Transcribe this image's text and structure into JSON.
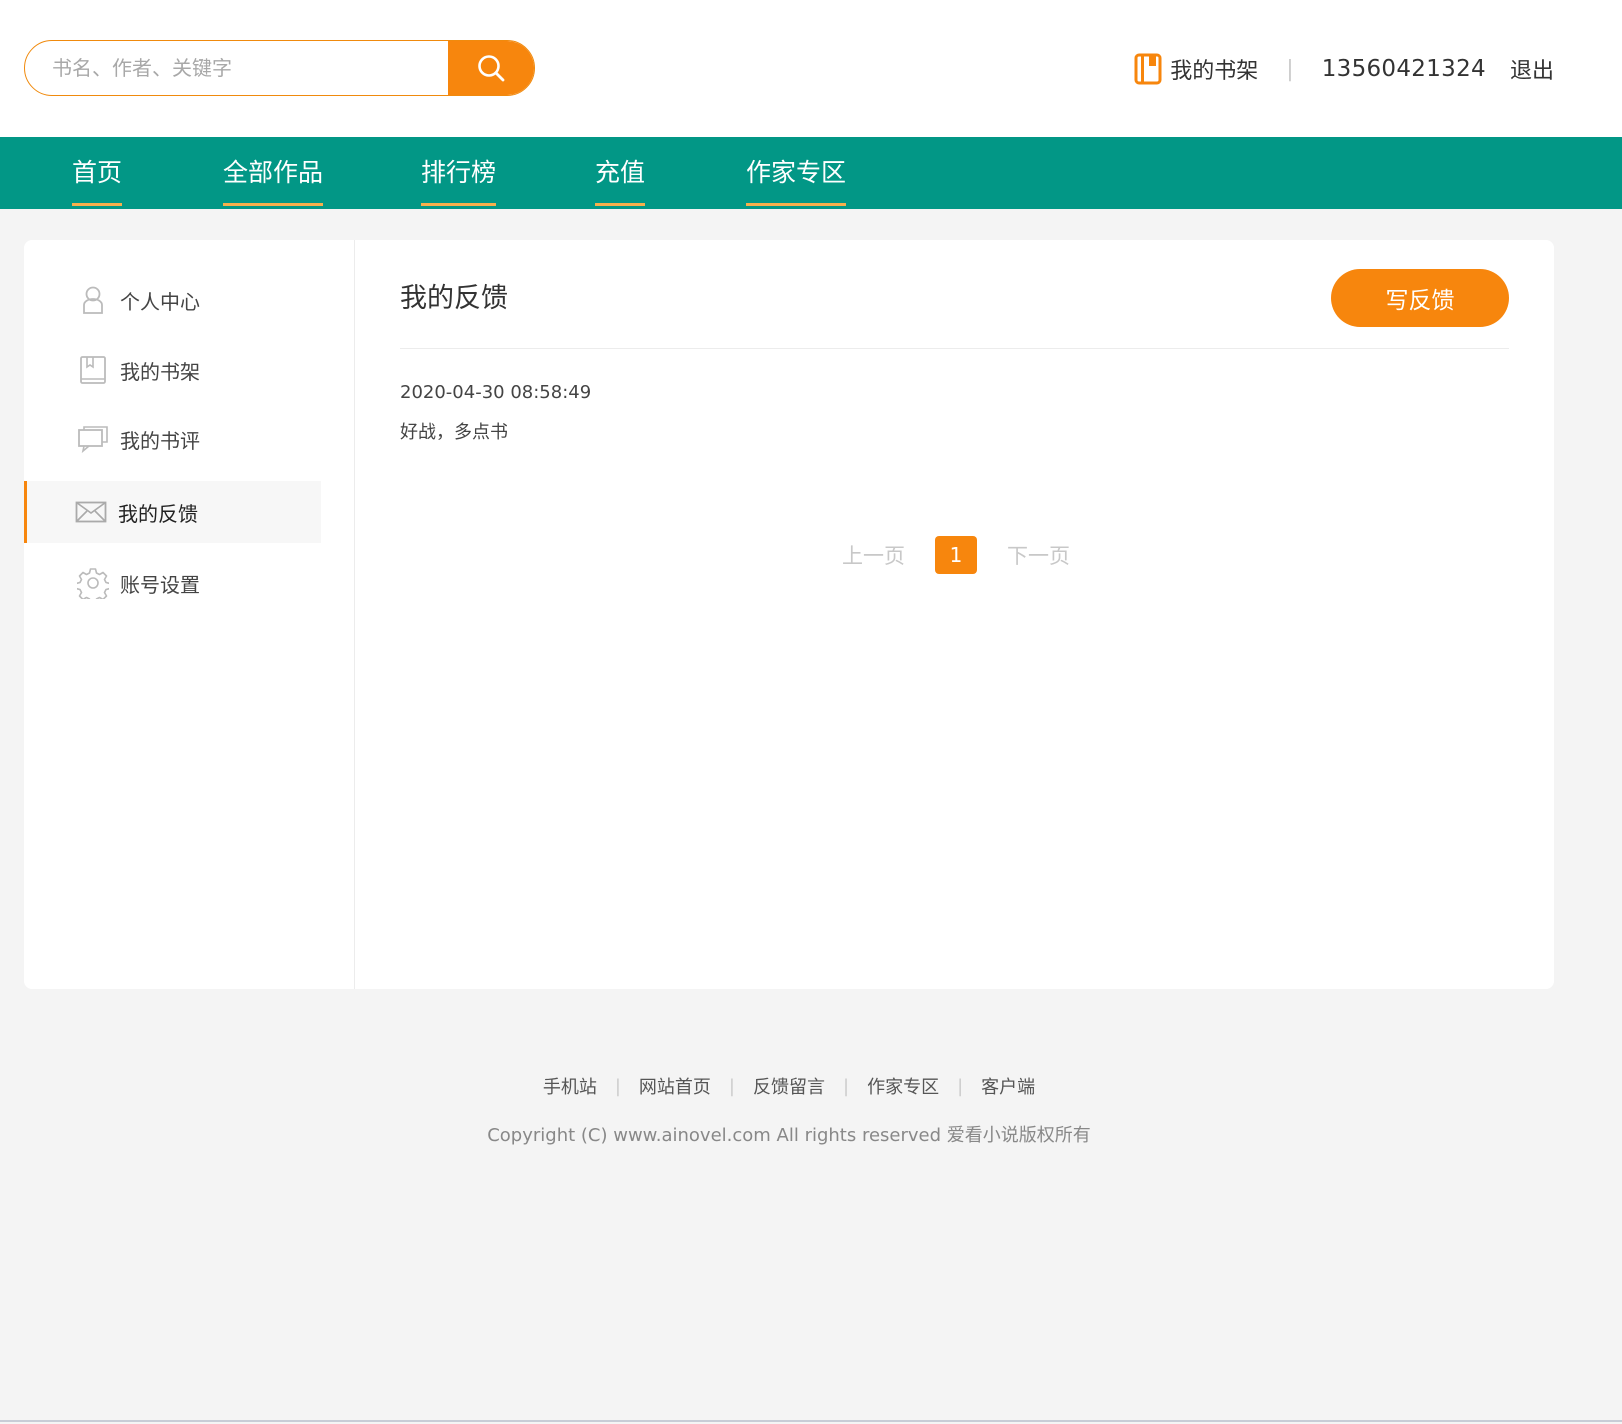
{
  "header": {
    "search_placeholder": "书名、作者、关键字",
    "shelf_label": "我的书架",
    "separator": "|",
    "phone": "13560421324",
    "logout_label": "退出"
  },
  "nav": {
    "items": [
      {
        "label": "首页"
      },
      {
        "label": "全部作品"
      },
      {
        "label": "排行榜"
      },
      {
        "label": "充值"
      },
      {
        "label": "作家专区"
      }
    ]
  },
  "sidebar": {
    "items": [
      {
        "label": "个人中心",
        "icon": "user-icon"
      },
      {
        "label": "我的书架",
        "icon": "book-icon"
      },
      {
        "label": "我的书评",
        "icon": "comment-icon"
      },
      {
        "label": "我的反馈",
        "icon": "mail-icon",
        "active": true
      },
      {
        "label": "账号设置",
        "icon": "gear-icon"
      }
    ]
  },
  "content": {
    "title": "我的反馈",
    "write_button": "写反馈",
    "feedback": [
      {
        "time": "2020-04-30 08:58:49",
        "text": "好战，多点书"
      }
    ]
  },
  "pager": {
    "prev": "上一页",
    "current": "1",
    "next": "下一页"
  },
  "footer": {
    "links": [
      "手机站",
      "网站首页",
      "反馈留言",
      "作家专区",
      "客户端"
    ],
    "separator": "|",
    "copyright": "Copyright (C) www.ainovel.com All rights reserved  爱看小说版权所有"
  },
  "colors": {
    "accent": "#f7860d",
    "nav_bg": "#029786",
    "nav_underline": "#f7b04c"
  }
}
